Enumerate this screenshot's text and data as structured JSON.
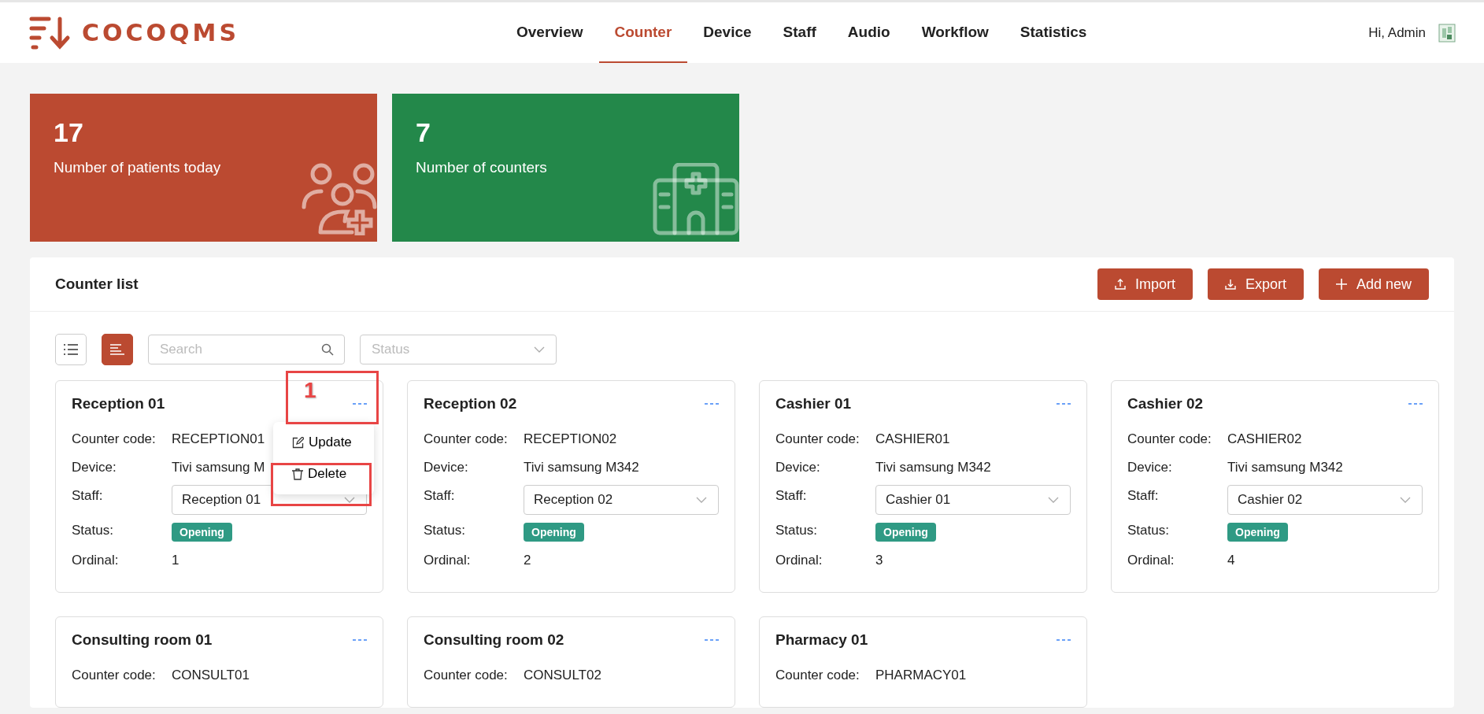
{
  "header": {
    "logo": "COCOQMS",
    "nav": [
      {
        "label": "Overview",
        "selected": false
      },
      {
        "label": "Counter",
        "selected": true
      },
      {
        "label": "Device",
        "selected": false
      },
      {
        "label": "Staff",
        "selected": false
      },
      {
        "label": "Audio",
        "selected": false
      },
      {
        "label": "Workflow",
        "selected": false
      },
      {
        "label": "Statistics",
        "selected": false
      }
    ],
    "greeting": "Hi, Admin"
  },
  "stats": [
    {
      "value": "17",
      "label": "Number of patients today",
      "kind": "patients",
      "color": "#bb4a31"
    },
    {
      "value": "7",
      "label": "Number of counters",
      "kind": "hospital",
      "color": "#23884a"
    }
  ],
  "panel": {
    "title": "Counter list",
    "actions": [
      {
        "label": "Import",
        "kind": "import"
      },
      {
        "label": "Export",
        "kind": "export"
      },
      {
        "label": "Add new",
        "kind": "add"
      }
    ],
    "view_modes": [
      {
        "kind": "list",
        "selected": false
      },
      {
        "kind": "cards",
        "selected": true
      }
    ],
    "search": {
      "placeholder": "Search"
    },
    "status_filter": {
      "placeholder": "Status"
    }
  },
  "cards": [
    {
      "title": "Reception 01",
      "menu_open": true,
      "fields": [
        {
          "label": "Counter code:",
          "value": "RECEPTION01",
          "kind": "text"
        },
        {
          "label": "Device:",
          "value": "Tivi samsung M",
          "kind": "text"
        },
        {
          "label": "Staff:",
          "value": "Reception 01",
          "kind": "select"
        },
        {
          "label": "Status:",
          "value": "Opening",
          "kind": "badge"
        },
        {
          "label": "Ordinal:",
          "value": "1",
          "kind": "text"
        }
      ]
    },
    {
      "title": "Reception 02",
      "menu_open": false,
      "fields": [
        {
          "label": "Counter code:",
          "value": "RECEPTION02",
          "kind": "text"
        },
        {
          "label": "Device:",
          "value": "Tivi samsung M342",
          "kind": "text"
        },
        {
          "label": "Staff:",
          "value": "Reception 02",
          "kind": "select"
        },
        {
          "label": "Status:",
          "value": "Opening",
          "kind": "badge"
        },
        {
          "label": "Ordinal:",
          "value": "2",
          "kind": "text"
        }
      ]
    },
    {
      "title": "Cashier 01",
      "menu_open": false,
      "fields": [
        {
          "label": "Counter code:",
          "value": "CASHIER01",
          "kind": "text"
        },
        {
          "label": "Device:",
          "value": "Tivi samsung M342",
          "kind": "text"
        },
        {
          "label": "Staff:",
          "value": "Cashier 01",
          "kind": "select"
        },
        {
          "label": "Status:",
          "value": "Opening",
          "kind": "badge"
        },
        {
          "label": "Ordinal:",
          "value": "3",
          "kind": "text"
        }
      ]
    },
    {
      "title": "Cashier 02",
      "menu_open": false,
      "fields": [
        {
          "label": "Counter code:",
          "value": "CASHIER02",
          "kind": "text"
        },
        {
          "label": "Device:",
          "value": "Tivi samsung M342",
          "kind": "text"
        },
        {
          "label": "Staff:",
          "value": "Cashier 02",
          "kind": "select"
        },
        {
          "label": "Status:",
          "value": "Opening",
          "kind": "badge"
        },
        {
          "label": "Ordinal:",
          "value": "4",
          "kind": "text"
        }
      ]
    },
    {
      "title": "Consulting room 01",
      "menu_open": false,
      "fields": [
        {
          "label": "Counter code:",
          "value": "CONSULT01",
          "kind": "text"
        }
      ]
    },
    {
      "title": "Consulting room 02",
      "menu_open": false,
      "fields": [
        {
          "label": "Counter code:",
          "value": "CONSULT02",
          "kind": "text"
        }
      ]
    },
    {
      "title": "Pharmacy 01",
      "menu_open": false,
      "fields": [
        {
          "label": "Counter code:",
          "value": "PHARMACY01",
          "kind": "text"
        }
      ]
    }
  ],
  "card_menu": {
    "items": [
      {
        "label": "Update",
        "kind": "edit"
      },
      {
        "label": "Delete",
        "kind": "delete"
      }
    ]
  },
  "annotation": {
    "label": "1"
  }
}
